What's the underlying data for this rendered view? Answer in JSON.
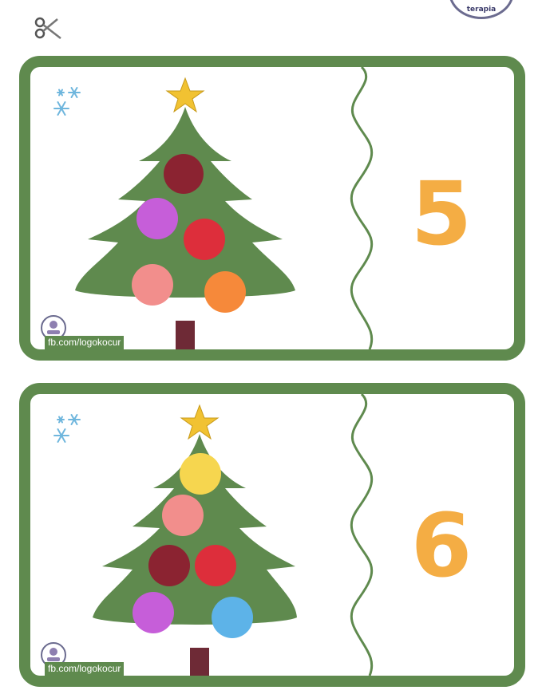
{
  "header": {
    "logo_text": "terapia"
  },
  "cards": [
    {
      "number": "5",
      "ornament_colors": [
        "#8b2331",
        "#c65ed9",
        "#dd2e3b",
        "#f28e8c",
        "#f6893a"
      ],
      "credit": "fb.com/logokocur"
    },
    {
      "number": "6",
      "ornament_colors": [
        "#f6d64f",
        "#f28e8c",
        "#8b2331",
        "#dd2e3b",
        "#c65ed9",
        "#5db3e8"
      ],
      "credit": "fb.com/logokocur"
    }
  ],
  "colors": {
    "frame": "#5f8a4e",
    "tree": "#5f8a4e",
    "trunk": "#6e2a36",
    "star": "#f1c232",
    "number": "#f4ad44",
    "snowflake": "#6fb6dd"
  },
  "icons": [
    "scissors-icon",
    "snowflake-icon",
    "star-icon",
    "christmas-tree-icon",
    "logo-seal-icon"
  ]
}
